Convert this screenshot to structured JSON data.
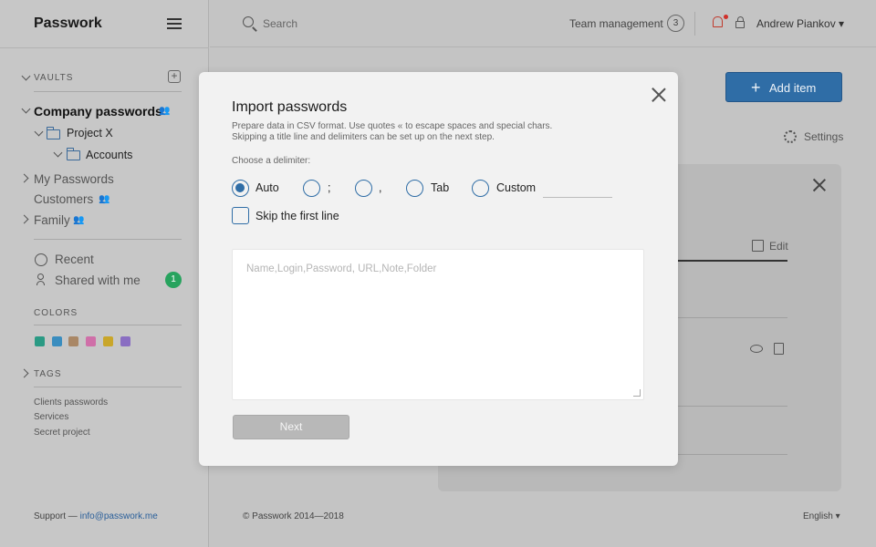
{
  "app": {
    "logo": "Passwork"
  },
  "sidebar": {
    "vaults_title": "VAULTS",
    "company": "Company passwords",
    "project": "Project X",
    "accounts": "Accounts",
    "items": [
      "My Passwords",
      "Customers",
      "Family"
    ],
    "recent": "Recent",
    "shared": "Shared with me",
    "shared_count": "1",
    "colors_title": "COLORS",
    "colors": [
      "#2a9a84",
      "#3a8dbf",
      "#a98766",
      "#cf6fa8",
      "#c9a62a",
      "#8a6ec2"
    ],
    "tags_title": "TAGS",
    "tags": [
      "Clients passwords",
      "Services",
      "Secret project"
    ],
    "support_prefix": "Support — ",
    "support_email": "info@passwork.me"
  },
  "header": {
    "search_placeholder": "Search",
    "team_label": "Team management",
    "team_count": "3",
    "user_name": "Andrew Piankov ▾"
  },
  "main": {
    "add_item": "Add item",
    "settings": "Settings",
    "edit": "Edit",
    "copyright": "© Passwork 2014—2018",
    "language": "English ▾"
  },
  "modal": {
    "title": "Import passwords",
    "desc_line1": "Prepare data in CSV format. Use quotes « to escape spaces and special chars.",
    "desc_line2": "Skipping a title line and delimiters can be set up on the next step.",
    "delimiter_label": "Choose a delimiter:",
    "options": [
      "Auto",
      ";",
      ",",
      "Tab",
      "Custom"
    ],
    "selected": "Auto",
    "skip_label": "Skip the first line",
    "textarea_placeholder": "Name,Login,Password, URL,Note,Folder",
    "next_label": "Next"
  }
}
